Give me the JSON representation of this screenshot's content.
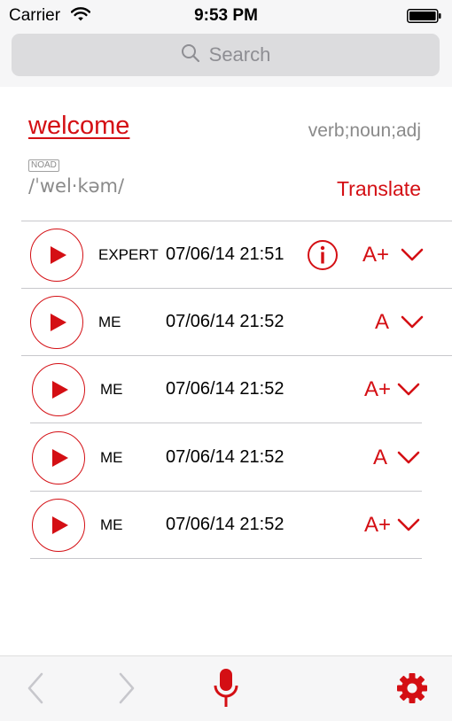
{
  "status_bar": {
    "carrier": "Carrier",
    "time": "9:53 PM"
  },
  "search": {
    "placeholder": "Search"
  },
  "entry": {
    "word": "welcome",
    "parts_of_speech": "verb;noun;adj",
    "dictionary": "NOAD",
    "pronunciation": "/ˈwel·kəm/",
    "translate_label": "Translate"
  },
  "recordings": [
    {
      "who": "EXPERT",
      "date": "07/06/14 21:51",
      "grade": "A+",
      "has_info": true
    },
    {
      "who": "ME",
      "date": "07/06/14 21:52",
      "grade": "A",
      "has_info": false
    },
    {
      "who": "ME",
      "date": "07/06/14 21:52",
      "grade": "A+",
      "has_info": false
    },
    {
      "who": "ME",
      "date": "07/06/14 21:52",
      "grade": "A",
      "has_info": false
    },
    {
      "who": "ME",
      "date": "07/06/14 21:52",
      "grade": "A+",
      "has_info": false
    }
  ],
  "toolbar": {
    "icons": [
      "back-icon",
      "forward-icon",
      "microphone-icon",
      "settings-icon"
    ]
  },
  "colors": {
    "accent": "#d40f14",
    "secondary_text": "#8a8a8a",
    "bar_background": "#f6f6f7",
    "disabled": "#c7c7cc"
  }
}
